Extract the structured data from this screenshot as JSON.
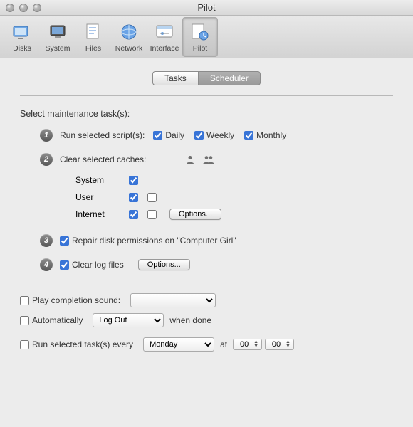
{
  "window": {
    "title": "Pilot"
  },
  "toolbar": {
    "items": [
      {
        "label": "Disks"
      },
      {
        "label": "System"
      },
      {
        "label": "Files"
      },
      {
        "label": "Network"
      },
      {
        "label": "Interface"
      },
      {
        "label": "Pilot"
      }
    ]
  },
  "tabs": {
    "tasks": "Tasks",
    "scheduler": "Scheduler"
  },
  "section_title": "Select maintenance task(s):",
  "steps": {
    "s1": {
      "label": "Run selected script(s):",
      "daily": "Daily",
      "weekly": "Weekly",
      "monthly": "Monthly"
    },
    "s2": {
      "label": "Clear selected caches:",
      "rows": {
        "system": "System",
        "user": "User",
        "internet": "Internet"
      },
      "options": "Options..."
    },
    "s3": {
      "label": "Repair disk permissions on \"Computer Girl\""
    },
    "s4": {
      "label": "Clear log files",
      "options": "Options..."
    }
  },
  "footer": {
    "play_sound": "Play completion sound:",
    "auto_pre": "Automatically",
    "auto_action": "Log Out",
    "auto_post": "when done",
    "run_every_pre": "Run selected task(s) every",
    "run_day": "Monday",
    "run_at": "at",
    "hh": "00",
    "mm": "00"
  }
}
